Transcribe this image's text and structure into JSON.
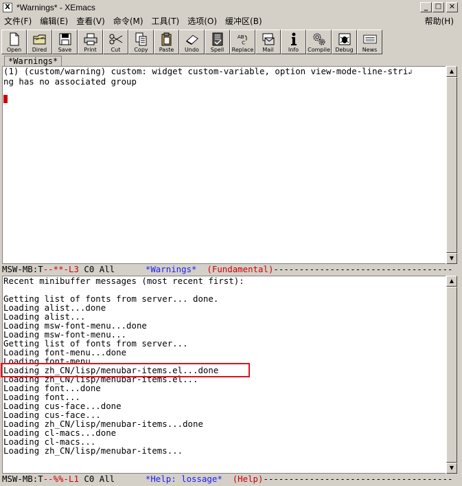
{
  "window": {
    "title": "*Warnings* - XEmacs",
    "icon_letter": "X",
    "minimize": "_",
    "maximize": "□",
    "close": "✕"
  },
  "menubar": {
    "items": [
      "文件(F)",
      "编辑(E)",
      "查看(V)",
      "命令(M)",
      "工具(T)",
      "选项(O)",
      "缓冲区(B)"
    ],
    "help": "帮助(H)"
  },
  "toolbar": {
    "buttons": [
      {
        "label": "Open",
        "icon": "open-file-icon"
      },
      {
        "label": "Dired",
        "icon": "dired-folder-icon"
      },
      {
        "label": "Save",
        "icon": "floppy-disk-icon"
      },
      {
        "label": "Print",
        "icon": "printer-icon"
      },
      {
        "label": "Cut",
        "icon": "scissors-icon"
      },
      {
        "label": "Copy",
        "icon": "copy-pages-icon"
      },
      {
        "label": "Paste",
        "icon": "clipboard-icon"
      },
      {
        "label": "Undo",
        "icon": "eraser-icon"
      },
      {
        "label": "Spell",
        "icon": "spellcheck-icon"
      },
      {
        "label": "Replace",
        "icon": "replace-abc-icon"
      },
      {
        "label": "Mail",
        "icon": "mail-icon"
      },
      {
        "label": "Info",
        "icon": "info-icon"
      },
      {
        "label": "Compile",
        "icon": "gears-icon"
      },
      {
        "label": "Debug",
        "icon": "bug-icon"
      },
      {
        "label": "News",
        "icon": "news-icon"
      }
    ]
  },
  "tab": {
    "label": "*Warnings*"
  },
  "upper_pane": {
    "lines": [
      "(1) (custom/warning) custom: widget custom-variable, option view-mode-line-stri",
      "ng has no associated group"
    ],
    "wrap_glyph": "↲"
  },
  "upper_modeline": {
    "prefix": "MSW-MB:T",
    "status": "--**-L3",
    "col": " C0 All",
    "buffer": "*Warnings*",
    "mode": "(Fundamental)",
    "dashes": "-----------------------------------"
  },
  "lower_pane": {
    "lines": [
      "Recent minibuffer messages (most recent first):",
      "",
      "Getting list of fonts from server... done.",
      "Loading alist...done",
      "Loading alist...",
      "Loading msw-font-menu...done",
      "Loading msw-font-menu...",
      "Getting list of fonts from server...",
      "Loading font-menu...done",
      "Loading font-menu...",
      "Loading zh_CN/lisp/menubar-items.el...done",
      "Loading zh_CN/lisp/menubar-items.el...",
      "Loading font...done",
      "Loading font...",
      "Loading cus-face...done",
      "Loading cus-face...",
      "Loading zh_CN/lisp/menubar-items...done",
      "Loading cl-macs...done",
      "Loading cl-macs...",
      "Loading zh_CN/lisp/menubar-items..."
    ]
  },
  "lower_modeline": {
    "prefix": "MSW-MB:T",
    "status": "--%%-L1",
    "col": " C0 All",
    "buffer": "*Help: lossage*",
    "mode": "(Help)",
    "dashes": "-------------------------------------"
  },
  "colors": {
    "chrome": "#d4d0c8",
    "modeline_blue": "#1a1aff",
    "modeline_red": "#cc0000",
    "highlight_box": "#e0101a"
  }
}
